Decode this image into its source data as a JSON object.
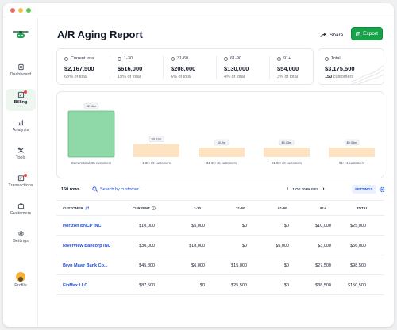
{
  "nav": {
    "items": [
      {
        "label": "Dashboard"
      },
      {
        "label": "Billing"
      },
      {
        "label": "Analysis"
      },
      {
        "label": "Tools"
      },
      {
        "label": "Transactions"
      },
      {
        "label": "Customers"
      },
      {
        "label": "Settings"
      }
    ],
    "profile": "Profile"
  },
  "header": {
    "title": "A/R Aging Report",
    "share_label": "Share",
    "export_label": "Export"
  },
  "summary": [
    {
      "label": "Current total",
      "amount": "$2,167,500",
      "sub": "68% of total"
    },
    {
      "label": "1-30",
      "amount": "$616,000",
      "sub": "19% of total"
    },
    {
      "label": "31-60",
      "amount": "$208,000",
      "sub": "6% of total"
    },
    {
      "label": "61-90",
      "amount": "$130,000",
      "sub": "4% of total"
    },
    {
      "label": "91+",
      "amount": "$54,000",
      "sub": "3% of total"
    }
  ],
  "total": {
    "label": "Total",
    "amount": "$3,175,500",
    "customers_count": "150",
    "customers_word": "customers"
  },
  "chart_data": {
    "type": "bar",
    "categories": [
      "Current total: 85 customers",
      "1-30: 30 customers",
      "31-60: 15 customers",
      "61-90: 10 customers",
      "91+: 1 customers"
    ],
    "values": [
      2.16,
      0.61,
      0.2,
      0.13,
      0.05
    ],
    "data_labels": [
      "$2.16m",
      "$0.61m",
      "$0.2m",
      "$0.13m",
      "$0.05m"
    ],
    "units": "millions USD",
    "colors": [
      "#8fd9a8",
      "#fde3c1",
      "#fde3c1",
      "#fde3c1",
      "#fde3c1"
    ]
  },
  "toolbar": {
    "rows": "150 rows",
    "search_placeholder": "Search by customer...",
    "page_info": "1 OF 30 PAGES",
    "settings_label": "SETTINGS"
  },
  "table": {
    "headers": [
      "CUSTOMER",
      "CURRENT",
      "1-30",
      "31-60",
      "61-90",
      "91+",
      "TOTAL"
    ],
    "rows": [
      [
        "Horizon BNCP INC",
        "$10,000",
        "$5,000",
        "$0",
        "$0",
        "$10,000",
        "$25,000"
      ],
      [
        "Riverview Bancorp INC",
        "$30,000",
        "$18,000",
        "$0",
        "$5,000",
        "$3,000",
        "$56,000"
      ],
      [
        "Bryn Mawr Bank Co...",
        "$45,800",
        "$6,000",
        "$15,000",
        "$0",
        "$27,500",
        "$98,500"
      ],
      [
        "FinMax LLC",
        "$87,500",
        "$0",
        "$25,500",
        "$0",
        "$38,500",
        "$150,500"
      ]
    ]
  },
  "colors": {
    "accent": "#16a34a",
    "link": "#1d4ed8",
    "bar_current": "#8fd9a8",
    "bar_other": "#fde3c1"
  }
}
